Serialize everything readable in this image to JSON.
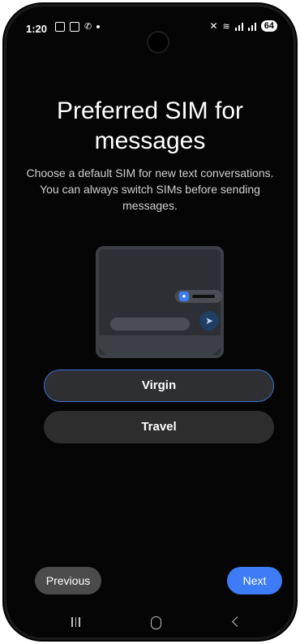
{
  "status_bar": {
    "time": "1:20",
    "battery": "64",
    "icons": [
      "screenshot-icon",
      "gallery-icon",
      "call-icon",
      "dot-icon",
      "mute-icon",
      "wifi-icon",
      "signal-icon",
      "signal-icon",
      "battery-icon"
    ]
  },
  "page": {
    "title": "Preferred SIM for messages",
    "subtitle": "Choose a default SIM for new text conversations. You can always switch SIMs before sending messages."
  },
  "illustration": {
    "icons": [
      "sim-badge-icon",
      "send-icon"
    ]
  },
  "sim_options": [
    {
      "label": "Virgin",
      "selected": true
    },
    {
      "label": "Travel",
      "selected": false
    }
  ],
  "footer": {
    "previous_label": "Previous",
    "next_label": "Next"
  },
  "nav_bar": {
    "icons": [
      "recent-apps-icon",
      "home-icon",
      "back-icon"
    ]
  },
  "colors": {
    "accent": "#3d7cf5",
    "selected_border": "#3e73d6",
    "background": "#050505",
    "option_background": "#2d2d2d"
  }
}
